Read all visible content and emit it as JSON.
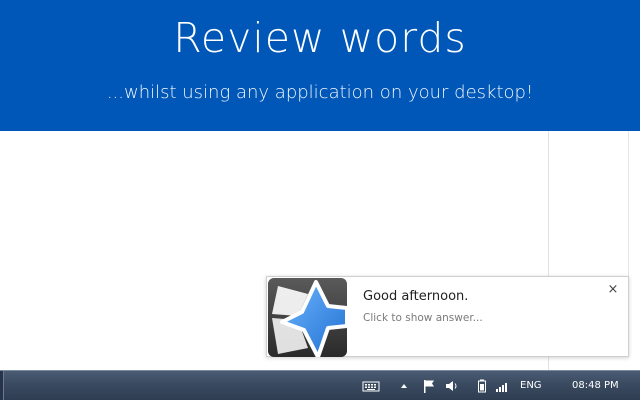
{
  "banner": {
    "title": "Review words",
    "subtitle": "...whilst using any application on your desktop!"
  },
  "notification": {
    "title": "Good afternoon.",
    "subtitle": "Click to show answer...",
    "close_glyph": "×",
    "icon": "anki-star-icon"
  },
  "taskbar": {
    "language": "ENG",
    "clock": "08:48 PM",
    "tray_icons": [
      "keyboard-icon",
      "show-hidden-icons-chevron",
      "action-center-flag-icon",
      "volume-icon",
      "battery-icon",
      "network-signal-icon"
    ]
  },
  "colors": {
    "banner_bg": "#0057b7",
    "banner_text": "#ffffff",
    "toast_border": "#cfcfcf",
    "taskbar_bg": "#3a4a60"
  }
}
